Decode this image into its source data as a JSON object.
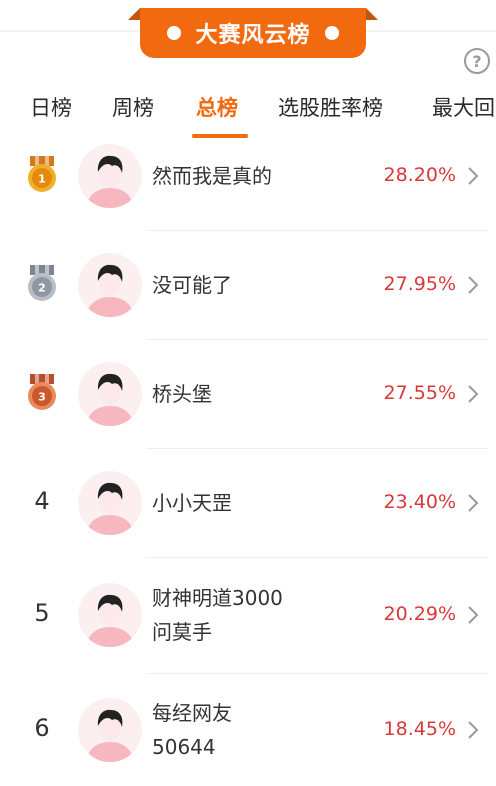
{
  "banner": {
    "title": "大赛风云榜"
  },
  "help": {
    "symbol": "?"
  },
  "tabs": [
    {
      "label": "日榜"
    },
    {
      "label": "周榜"
    },
    {
      "label": "总榜"
    },
    {
      "label": "选股胜率榜"
    },
    {
      "label": "最大回"
    }
  ],
  "colors": {
    "accent": "#f26a10",
    "percent": "#d9383a",
    "gold": "#e8a21a",
    "silver": "#9aa3ad",
    "bronze": "#d9683f"
  },
  "rows": [
    {
      "rank": "1",
      "medal": "gold-medal-icon",
      "name_line1": "然而我是真的",
      "name_line2": "",
      "percent": "28.20%"
    },
    {
      "rank": "2",
      "medal": "silver-medal-icon",
      "name_line1": "没可能了",
      "name_line2": "",
      "percent": "27.95%"
    },
    {
      "rank": "3",
      "medal": "bronze-medal-icon",
      "name_line1": "桥头堡",
      "name_line2": "",
      "percent": "27.55%"
    },
    {
      "rank": "4",
      "medal": "",
      "name_line1": "小小天罡",
      "name_line2": "",
      "percent": "23.40%"
    },
    {
      "rank": "5",
      "medal": "",
      "name_line1": "财神明道3000",
      "name_line2": "问莫手",
      "percent": "20.29%"
    },
    {
      "rank": "6",
      "medal": "",
      "name_line1": "每经网友",
      "name_line2": "50644",
      "percent": "18.45%"
    }
  ]
}
